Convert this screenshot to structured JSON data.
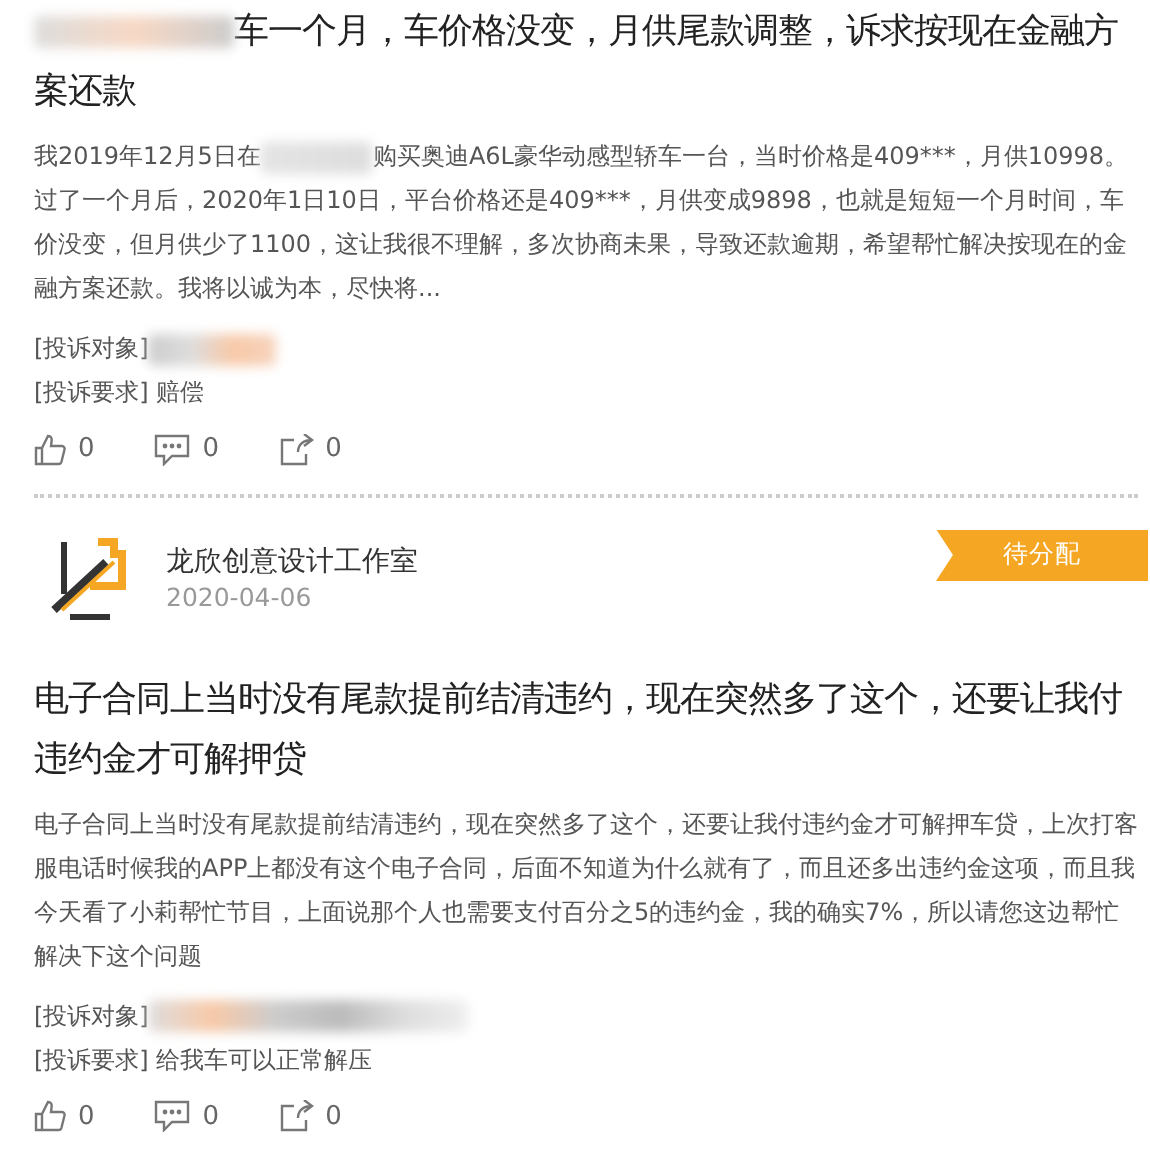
{
  "posts": [
    {
      "title": "车一个月，车价格没变，月供尾款调整，诉求按现在金融方案还款",
      "title_redacted": true,
      "body_parts": [
        "我2019年12月5日在",
        "购买奥迪A6L豪华动感型轿车一台，当时价格是409***，月供10998。过了一个月后，2020年1日10日，平台价格还是409***，月供变成9898，也就是短短一个月时间，车价没变，但月供少了1100，这让我很不理解，多次协商未果，导致还款逾期，希望帮忙解决按现在的金融方案还款。我将以诚为本，尽快将..."
      ],
      "target_label": "[投诉对象]",
      "target_redacted": true,
      "request_label": "[投诉要求]",
      "request": "赔偿",
      "likes": "0",
      "comments": "0",
      "shares": "0"
    },
    {
      "author": {
        "name": "龙欣创意设计工作室",
        "date": "2020-04-06",
        "status": "待分配"
      },
      "title": "电子合同上当时没有尾款提前结清违约，现在突然多了这个，还要让我付违约金才可解押贷",
      "title_redacted": false,
      "body_parts": [
        "电子合同上当时没有尾款提前结清违约，现在突然多了这个，还要让我付违约金才可解押车贷，上次打客服电话时候我的APP上都没有这个电子合同，后面不知道为什么就有了，而且还多出违约金这项，而且我今天看了小莉帮忙节目，上面说那个人也需要支付百分之5的违约金，我的确实7%，所以请您这边帮忙解决下这个问题"
      ],
      "target_label": "[投诉对象]",
      "target_redacted": true,
      "request_label": "[投诉要求]",
      "request": "给我车可以正常解压",
      "likes": "0",
      "comments": "0",
      "shares": "0"
    }
  ]
}
